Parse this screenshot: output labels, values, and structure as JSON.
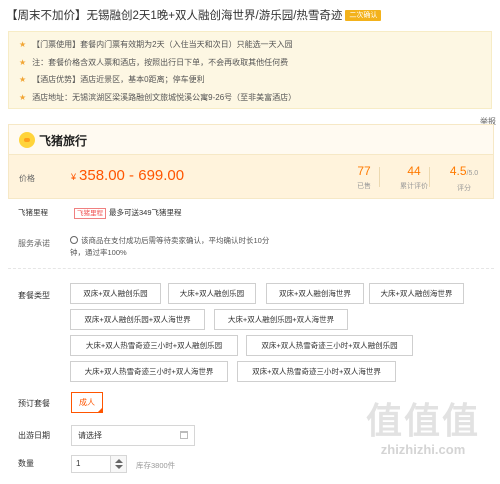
{
  "product": {
    "title": "【周末不加价】无锡融创2天1晚+双人融创海世界/游乐园/热雪奇迹",
    "tag": "二次确认"
  },
  "notes": [
    "【门票使用】套餐内门票有效期为2天（入住当天和次日）只能选一天入园",
    "注：套餐价格含双人票和酒店，按照出行日下单，不会再收取其他任何费",
    "【酒店优势】酒店近景区，基本0距离；停车便利",
    "酒店地址：无锡滨湖区梁溪路融创文旅城悦溪公寓9-26号（至非美富酒店）"
  ],
  "top_right": "举报",
  "brand": {
    "name": "飞猪旅行"
  },
  "price": {
    "label": "价格",
    "currency": "¥",
    "range": "358.00 - 699.00"
  },
  "stats": [
    {
      "value": "77",
      "unit": "",
      "label": "已售"
    },
    {
      "value": "44",
      "unit": "",
      "label": "累计评价"
    },
    {
      "value": "4.5",
      "unit": "/5.0",
      "label": "评分"
    }
  ],
  "miles": {
    "label": "飞猪里程",
    "tag": "飞猪里程",
    "text": "最多可送349飞猪里程"
  },
  "service": {
    "label": "服务承诺",
    "text": "该商品在支付成功后需等待卖家确认，平均确认时长10分钟，通过率100%"
  },
  "package": {
    "label": "套餐类型",
    "options": [
      "双床+双人融创乐园",
      "大床+双人融创乐园",
      "双床+双人融创海世界",
      "大床+双人融创海世界",
      "双床+双人融创乐园+双人海世界",
      "大床+双人融创乐园+双人海世界",
      "大床+双人热雪奇迹三小时+双人融创乐园",
      "双床+双人热雪奇迹三小时+双人融创乐园",
      "大床+双人热雪奇迹三小时+双人海世界",
      "双床+双人热雪奇迹三小时+双人海世界"
    ]
  },
  "booking": {
    "label": "预订套餐",
    "selected": "成人"
  },
  "date": {
    "label": "出游日期",
    "placeholder": "请选择"
  },
  "quantity": {
    "label": "数量",
    "value": "1",
    "stock": "库存3800件"
  },
  "watermark": {
    "big": "值值值",
    "small": "zhizhizhi.com"
  },
  "colors": {
    "accent": "#ff5500",
    "brand_yellow": "#ffd43b",
    "star": "#f2a534",
    "tag": "#f3b21b"
  }
}
